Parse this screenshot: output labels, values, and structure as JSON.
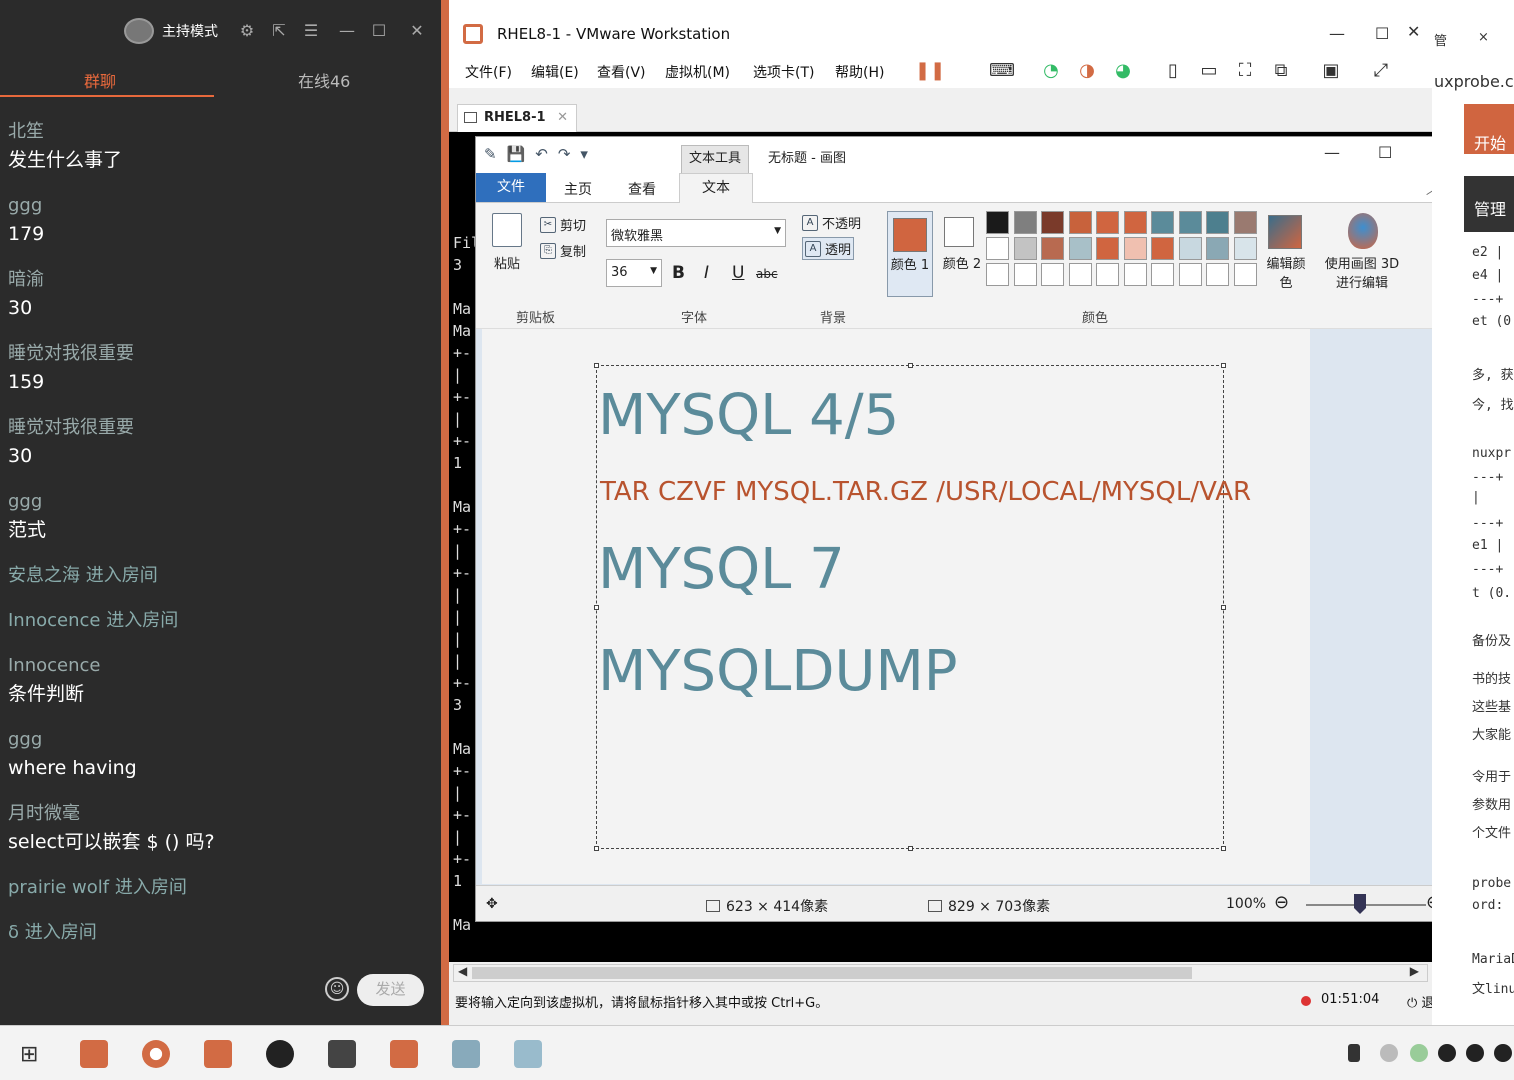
{
  "chat": {
    "mode_label": "主持模式",
    "tabs": [
      {
        "label": "群聊"
      },
      {
        "label": "在线46"
      }
    ],
    "messages": [
      {
        "user": "北笙",
        "text": "发生什么事了"
      },
      {
        "user": "ggg",
        "text": "179"
      },
      {
        "user": "暗渝",
        "text": "30"
      },
      {
        "user": "睡觉对我很重要",
        "text": "159"
      },
      {
        "user": "睡觉对我很重要",
        "text": "30"
      },
      {
        "user": "ggg",
        "text": "范式"
      }
    ],
    "system_1": "安息之海 进入房间",
    "system_2": "Innocence 进入房间",
    "messages_2": [
      {
        "user": "Innocence",
        "text": "条件判断"
      },
      {
        "user": "ggg",
        "text": "where  having"
      },
      {
        "user": "月时微毫",
        "text": "select可以嵌套 $ () 吗?"
      }
    ],
    "system_3": "prairie wolf 进入房间",
    "system_4": "δ 进入房间",
    "send_label": "发送"
  },
  "vmware": {
    "title": "RHEL8-1 - VMware Workstation",
    "menu": [
      "文件(F)",
      "编辑(E)",
      "查看(V)",
      "虚拟机(M)",
      "选项卡(T)",
      "帮助(H)"
    ],
    "tab_label": "RHEL8-1",
    "status_hint": "要将输入定向到该虚拟机，请将鼠标指针移入其中或按 Ctrl+G。",
    "timer": "01:51:04",
    "exit_share": "退出分享"
  },
  "terminal_left": [
    "Fil",
    "3",
    "",
    "Ma",
    "Ma",
    "+-",
    "|",
    "+-",
    "|",
    "+-",
    "1",
    "",
    "Ma",
    "+-",
    "|",
    "+-",
    "|",
    "|",
    "|",
    "|",
    "+-",
    "3",
    "",
    "Ma",
    "+-",
    "|",
    "+-",
    "|",
    "+-",
    "1",
    "",
    "Ma"
  ],
  "paint": {
    "context_tab": "文本工具",
    "doc_title": "无标题 - 画图",
    "tabs": {
      "file": "文件",
      "home": "主页",
      "view": "查看",
      "text": "文本"
    },
    "clipboard": {
      "paste": "粘贴",
      "cut": "剪切",
      "copy": "复制",
      "label": "剪贴板"
    },
    "font": {
      "name": "微软雅黑",
      "size": "36",
      "bold": "B",
      "italic": "I",
      "underline": "U",
      "strike": "abc",
      "label": "字体"
    },
    "background": {
      "opaque": "不透明",
      "transparent": "透明",
      "label": "背景"
    },
    "colors": {
      "color1_label": "颜色 1",
      "color2_label": "颜色 2",
      "edit_label": "编辑颜色",
      "label": "颜色",
      "palette_row1": [
        "#1a1a1a",
        "#7f7f7f",
        "#7a3a2a",
        "#c8623c",
        "#d06540",
        "#d06540",
        "#5b8b9a",
        "#5b8b9a",
        "#4d7f8e",
        "#9a7a70"
      ],
      "palette_row2": [
        "#ffffff",
        "#c3c3c3",
        "#b86a50",
        "#a8c0c8",
        "#d06540",
        "#f0c0b0",
        "#d06540",
        "#c8d8e0",
        "#8aa8b4",
        "#d8e4ea"
      ],
      "color1_hex": "#d06540",
      "color2_hex": "#ffffff"
    },
    "paint3d_label": "使用画图 3D 进行编辑",
    "canvas_lines": [
      "MYSQL 4/5",
      "TAR CZVF MYSQL.TAR.GZ /USR/LOCAL/MYSQL/VAR",
      "MYSQL 7",
      "MYSQLDUMP"
    ],
    "status": {
      "selection": "623 × 414像素",
      "image_size": "829 × 703像素",
      "zoom": "100%"
    }
  },
  "right_strip": {
    "lines_top": [
      "管",
      "×",
      "uxprobe.c",
      "开始",
      "管理"
    ],
    "lines_mid": [
      "e2  |",
      "e4  |",
      "---+",
      "et (0",
      "多, 获",
      "今, 找",
      "nuxpr",
      "---+",
      "  |",
      "---+",
      "e1  |",
      "---+",
      "t (0.",
      "备份及",
      "书的技",
      "这些基",
      "大家能",
      "令用于",
      "参数用",
      "个文件",
      "probe",
      "ord:",
      "MariaDB数",
      "文linuxpro"
    ]
  }
}
